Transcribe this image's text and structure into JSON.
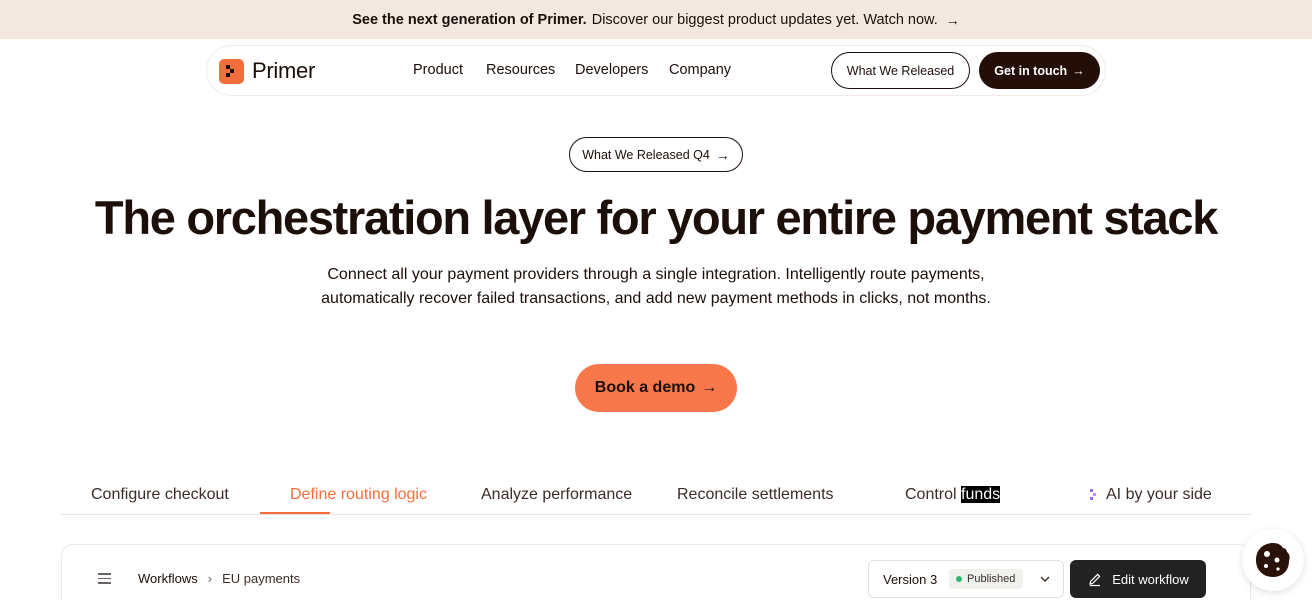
{
  "announcement": {
    "bold": "See the next generation of Primer.",
    "text": "Discover our biggest product updates yet. Watch now.",
    "arrow": "→"
  },
  "nav": {
    "logo_text": "Primer",
    "items": [
      "Product",
      "Resources",
      "Developers",
      "Company"
    ],
    "released_button": "What We Released",
    "contact_button": "Get in touch",
    "arrow": "→"
  },
  "hero": {
    "pill": "What We Released Q4",
    "pill_arrow": "→",
    "headline": "The orchestration layer for your entire payment stack",
    "subtext": "Connect all your payment providers through a single integration. Intelligently route payments, automatically recover failed transactions, and add new payment methods in clicks, not months.",
    "cta": "Book a demo",
    "cta_arrow": "→"
  },
  "tabs": {
    "items": [
      {
        "label": "Configure checkout"
      },
      {
        "label": "Define routing logic",
        "active": true
      },
      {
        "label": "Analyze performance"
      },
      {
        "label": "Reconcile settlements"
      },
      {
        "label_prefix": "Control ",
        "label_highlight": "funds"
      },
      {
        "label": "AI by your side",
        "icon": "sparkle-icon"
      }
    ],
    "active_color": "#f26f3b"
  },
  "workflow": {
    "crumb_root": "Workflows",
    "crumb_sep": "›",
    "crumb_current": "EU payments",
    "version": "Version 3",
    "status": "Published",
    "edit_button": "Edit workflow"
  },
  "colors": {
    "brand_orange": "#f7794b",
    "dark": "#230f08",
    "announcement_bg": "#f3e8e0",
    "published_dot": "#2fb772"
  },
  "icons": [
    "logo-icon",
    "arrow-right-icon",
    "menu-icon",
    "chevron-down-icon",
    "pencil-icon",
    "cookie-icon",
    "sparkle-icon"
  ]
}
